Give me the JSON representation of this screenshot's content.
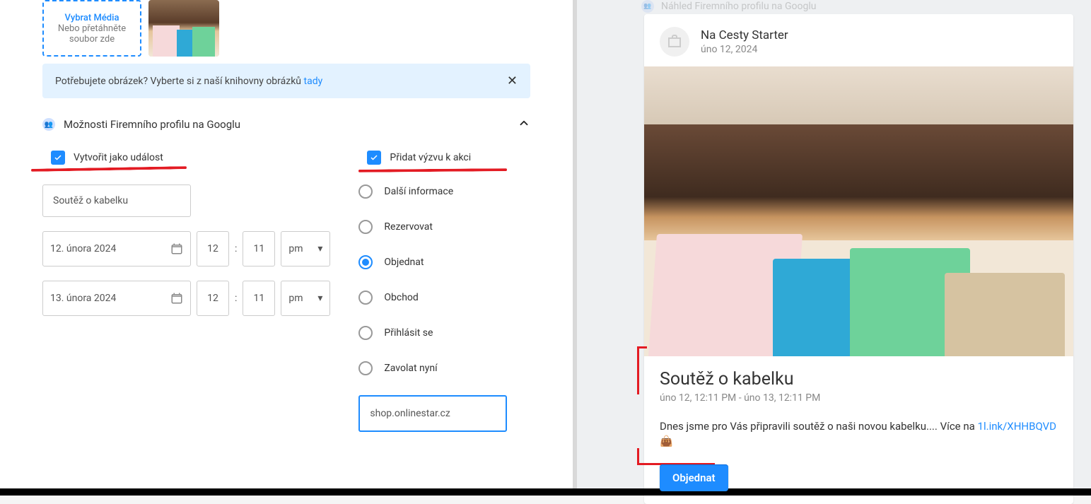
{
  "upload": {
    "title": "Vybrat Média",
    "sub1": "Nebo přetáhněte",
    "sub2": "soubor zde"
  },
  "banner": {
    "text": "Potřebujete obrázek? Vyberte si z naší knihovny obrázků ",
    "link": "tady"
  },
  "section": {
    "title": "Možnosti Firemního profilu na Googlu"
  },
  "event": {
    "check_label": "Vytvořit jako událost",
    "name": "Soutěž o kabelku",
    "start": {
      "date": "12. února 2024",
      "h": "12",
      "m": "11",
      "ampm": "pm"
    },
    "end": {
      "date": "13. února 2024",
      "h": "12",
      "m": "11",
      "ampm": "pm"
    }
  },
  "cta": {
    "check_label": "Přidat výzvu k akci",
    "options": [
      {
        "label": "Další informace",
        "selected": false
      },
      {
        "label": "Rezervovat",
        "selected": false
      },
      {
        "label": "Objednat",
        "selected": true
      },
      {
        "label": "Obchod",
        "selected": false
      },
      {
        "label": "Přihlásit se",
        "selected": false
      },
      {
        "label": "Zavolat nyní",
        "selected": false
      }
    ],
    "url": "shop.onlinestar.cz"
  },
  "preview": {
    "panel_title": "Náhled Firemního profilu na Googlu",
    "business": "Na Cesty Starter",
    "post_date": "úno 12, 2024",
    "ev_title": "Soutěž o kabelku",
    "ev_dates": "úno 12, 12:11 PM - úno 13, 12:11 PM",
    "desc_pre": "Dnes jsme pro Vás připravili soutěž o naši novou kabelku.... Více na ",
    "desc_link": "1l.ink/XHHBQVD",
    "desc_emoji": "👜",
    "cta_label": "Objednat"
  }
}
